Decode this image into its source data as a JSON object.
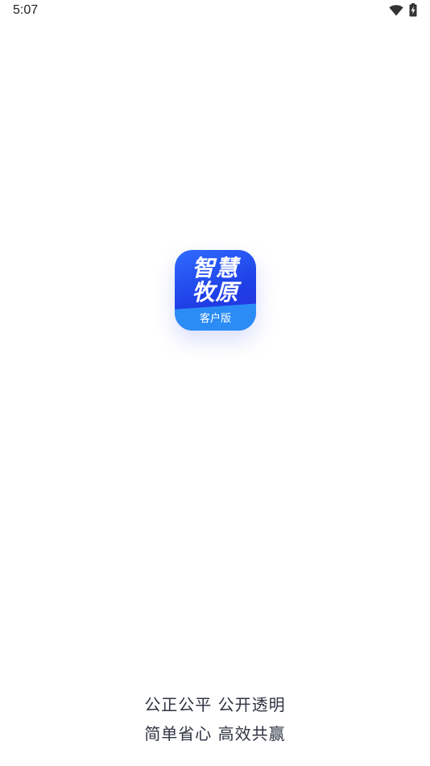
{
  "status_bar": {
    "time": "5:07",
    "icons": [
      "wifi-icon",
      "battery-icon"
    ]
  },
  "logo": {
    "title_line1": "智慧",
    "title_line2": "牧原",
    "subtitle": "客户版",
    "colors": {
      "gradient_top": "#2f6cff",
      "gradient_bottom": "#2a2fd8",
      "band": "#2b8cf6",
      "text": "#ffffff"
    }
  },
  "slogans": {
    "line1": "公正公平 公开透明",
    "line2": "简单省心 高效共赢"
  },
  "colors": {
    "background": "#ffffff",
    "slogan_text": "#2e3442"
  }
}
